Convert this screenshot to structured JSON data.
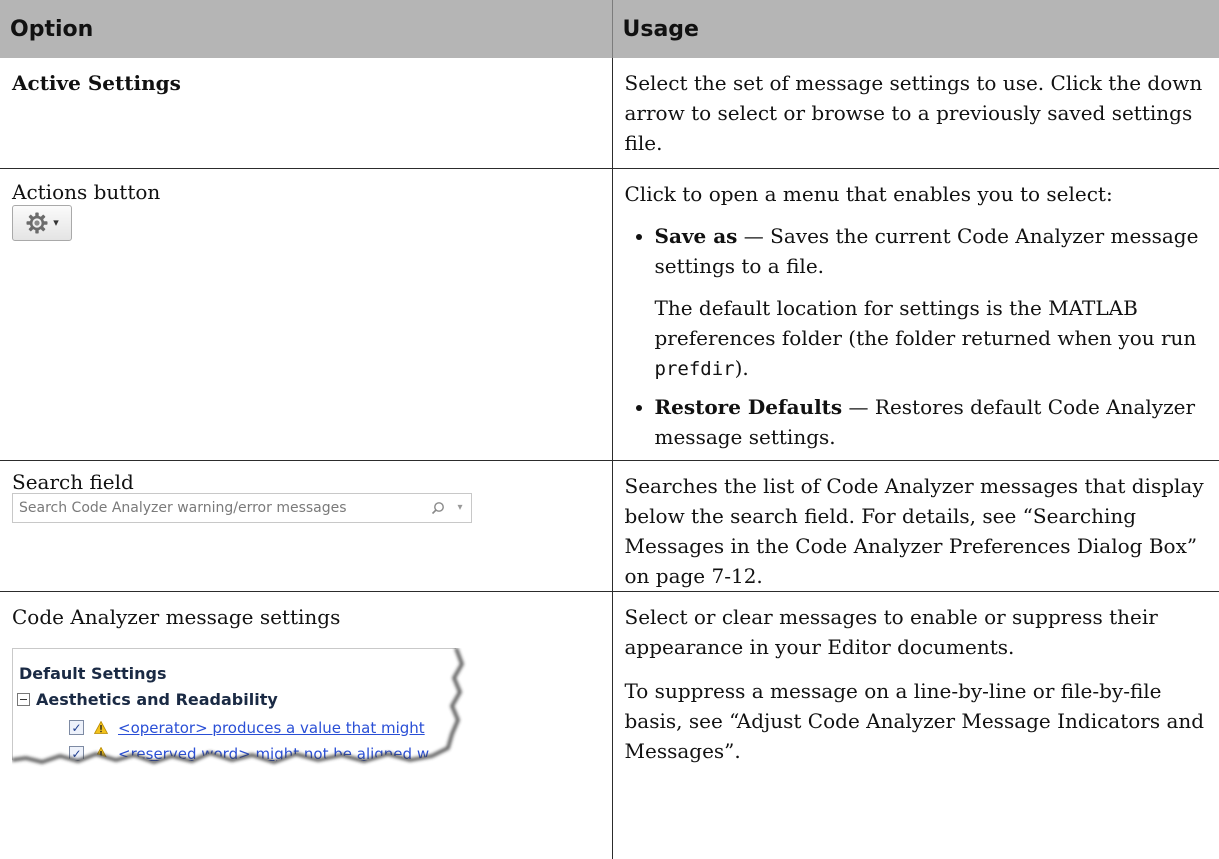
{
  "header": {
    "option": "Option",
    "usage": "Usage"
  },
  "rows": {
    "active": {
      "option": "Active Settings",
      "usage": "Select the set of message settings to use. Click the down arrow to select or browse to a previously saved settings file."
    },
    "actions": {
      "option": "Actions button",
      "button_icon": "gear-icon",
      "intro": "Click to open a menu that enables you to select:",
      "item1_bold": "Save as",
      "item1_text": " — Saves the current Code Analyzer message settings to a file.",
      "item1_sub_before": "The default location for settings is the MATLAB preferences folder (the folder returned when you run ",
      "item1_sub_code": "prefdir",
      "item1_sub_after": ").",
      "item2_bold": "Restore Defaults",
      "item2_text": " — Restores default Code Analyzer message settings."
    },
    "search": {
      "option": "Search field",
      "placeholder": "Search Code Analyzer warning/error messages",
      "usage": "Searches the list of Code Analyzer messages that display below the search field. For details, see “Searching Messages in the Code Analyzer Preferences Dialog Box” on page 7-12."
    },
    "messages": {
      "option": "Code Analyzer message settings",
      "preview_title": "Default Settings",
      "preview_category": "Aesthetics and Readability",
      "preview_item1": "<operator> produces a value that might",
      "preview_item2": "<reserved word> might not be aligned w",
      "usage1": "Select or clear messages to enable or suppress their appearance in your Editor documents.",
      "usage2": "To suppress a message on a line-by-line or file-by-file basis, see “Adjust Code Analyzer Message Indicators and Messages”."
    }
  }
}
